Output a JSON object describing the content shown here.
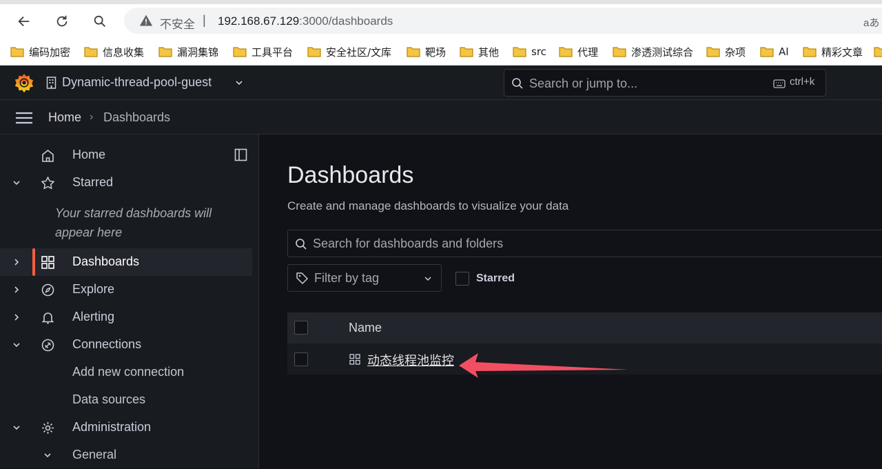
{
  "browser": {
    "insecure_label": "不安全",
    "separator": "|",
    "url_host": "192.168.67.129",
    "url_rest": ":3000/dashboards",
    "translate_icon": "translate-icon",
    "bookmarks": [
      "编码加密",
      "信息收集",
      "漏洞集锦",
      "工具平台",
      "安全社区/文库",
      "靶场",
      "其他",
      "src",
      "代理",
      "渗透测试综合",
      "杂项",
      "AI",
      "精彩文章"
    ]
  },
  "topbar": {
    "org_name": "Dynamic-thread-pool-guest",
    "search_placeholder": "Search or jump to...",
    "shortcut": "ctrl+k"
  },
  "breadcrumb": {
    "home": "Home",
    "separator": "›",
    "current": "Dashboards"
  },
  "sidebar": {
    "items": [
      {
        "label": "Home",
        "icon": "home-icon"
      },
      {
        "label": "Starred",
        "icon": "star-icon"
      },
      {
        "label": "Dashboards",
        "icon": "apps-icon"
      },
      {
        "label": "Explore",
        "icon": "compass-icon"
      },
      {
        "label": "Alerting",
        "icon": "bell-icon"
      },
      {
        "label": "Connections",
        "icon": "link-icon"
      },
      {
        "label": "Add new connection"
      },
      {
        "label": "Data sources"
      },
      {
        "label": "Administration",
        "icon": "cog-icon"
      },
      {
        "label": "General"
      }
    ],
    "starred_empty": "Your starred dashboards will appear here"
  },
  "main": {
    "title": "Dashboards",
    "subtitle": "Create and manage dashboards to visualize your data",
    "search_placeholder": "Search for dashboards and folders",
    "tag_filter_placeholder": "Filter by tag",
    "starred_filter_label": "Starred",
    "column_name": "Name",
    "results": [
      {
        "title": "动态线程池监控"
      }
    ]
  },
  "colors": {
    "accent": "#f55f3e",
    "annotation_arrow": "#f24e62",
    "background": "#111217",
    "panel": "#181b1f"
  }
}
